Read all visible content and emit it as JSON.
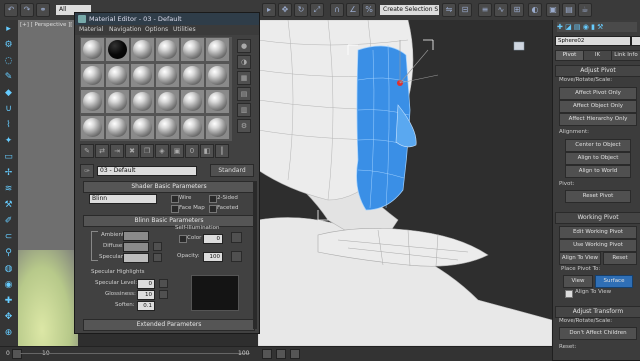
{
  "toolbar": {
    "filter_dropdown": "All",
    "selection_set_dropdown": "Create Selection S"
  },
  "viewport_left": {
    "label": "[+] [ Perspective ][ S"
  },
  "material_editor": {
    "title": "Material Editor - 03 - Default",
    "menu": [
      "Material",
      "Navigation",
      "Options",
      "Utilities"
    ],
    "material_name": "03 - Default",
    "material_type": "Standard",
    "shader_rollout": {
      "header": "Shader Basic Parameters",
      "shader": "Blinn",
      "wire": "Wire",
      "two_sided": "2-Sided",
      "face_map": "Face Map",
      "faceted": "Faceted"
    },
    "blinn_rollout": {
      "header": "Blinn Basic Parameters",
      "self_illumination": "Self-Illumination",
      "color": "Color",
      "color_value": "0",
      "ambient": "Ambient:",
      "diffuse": "Diffuse:",
      "specular": "Specular:",
      "opacity": "Opacity:",
      "opacity_value": "100",
      "specular_highlights": "Specular Highlights",
      "specular_level": "Specular Level:",
      "specular_level_value": "0",
      "glossiness": "Glossiness:",
      "glossiness_value": "10",
      "soften": "Soften:",
      "soften_value": "0.1"
    },
    "extended_rollout": {
      "header": "Extended Parameters"
    }
  },
  "right_panel": {
    "object_name": "Sphere02",
    "tabs": [
      "Pivot",
      "IK",
      "Link Info"
    ],
    "adjust_pivot": {
      "header": "Adjust Pivot",
      "move_rotate_scale": "Move/Rotate/Scale:",
      "buttons": [
        "Affect Pivot Only",
        "Affect Object Only",
        "Affect Hierarchy Only"
      ],
      "alignment": "Alignment:",
      "align_buttons": [
        "Center to Object",
        "Align to Object",
        "Align to World"
      ],
      "pivot": "Pivot:",
      "reset_pivot": "Reset Pivot"
    },
    "working_pivot": {
      "header": "Working Pivot",
      "edit": "Edit Working Pivot",
      "use": "Use Working Pivot",
      "align_to_view": "Align To View",
      "reset": "Reset",
      "place_pivot_to": "Place Pivot To:",
      "view": "View",
      "surface": "Surface",
      "align_to_view_check": "Align To View"
    },
    "adjust_transform": {
      "header": "Adjust Transform",
      "move_rotate_scale": "Move/Rotate/Scale:",
      "dont_affect_children": "Don't Affect Children",
      "reset": "Reset:"
    }
  },
  "timeline": {
    "frame_0": "0",
    "frame_10": "10",
    "frame_100": "100"
  }
}
